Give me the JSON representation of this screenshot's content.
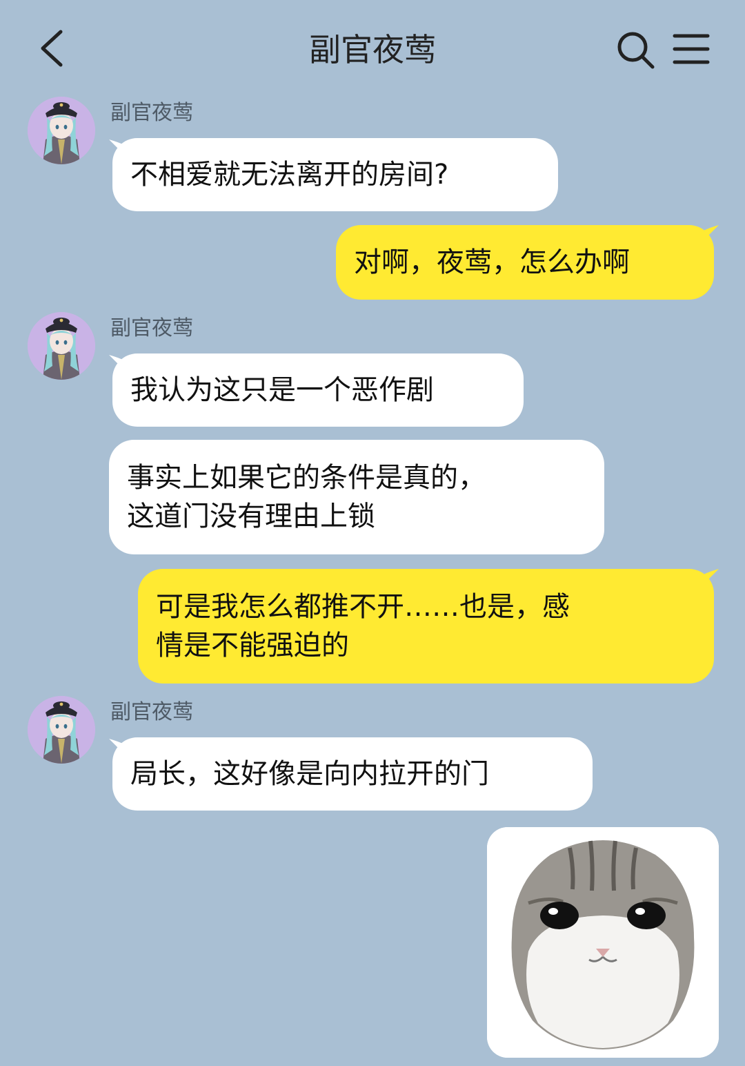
{
  "header": {
    "title": "副官夜莺",
    "back_icon": "chevron-left-icon",
    "search_icon": "search-icon",
    "menu_icon": "menu-icon"
  },
  "colors": {
    "background": "#a9bfd3",
    "incoming_bubble": "#ffffff",
    "outgoing_bubble": "#ffea32"
  },
  "messages": [
    {
      "sender": "副官夜莺",
      "text": "不相爱就无法离开的房间?"
    },
    {
      "text": "对啊，夜莺，怎么办啊"
    },
    {
      "sender": "副官夜莺",
      "text": "我认为这只是一个恶作剧"
    },
    {
      "text_line1": "事实上如果它的条件是真的，",
      "text_line2": "这道门没有理由上锁"
    },
    {
      "text_line1": "可是我怎么都推不开……也是，感",
      "text_line2": "情是不能强迫的"
    },
    {
      "sender": "副官夜莺",
      "text": "局长，这好像是向内拉开的门"
    },
    {
      "sticker": "crying-cat-sticker"
    }
  ]
}
